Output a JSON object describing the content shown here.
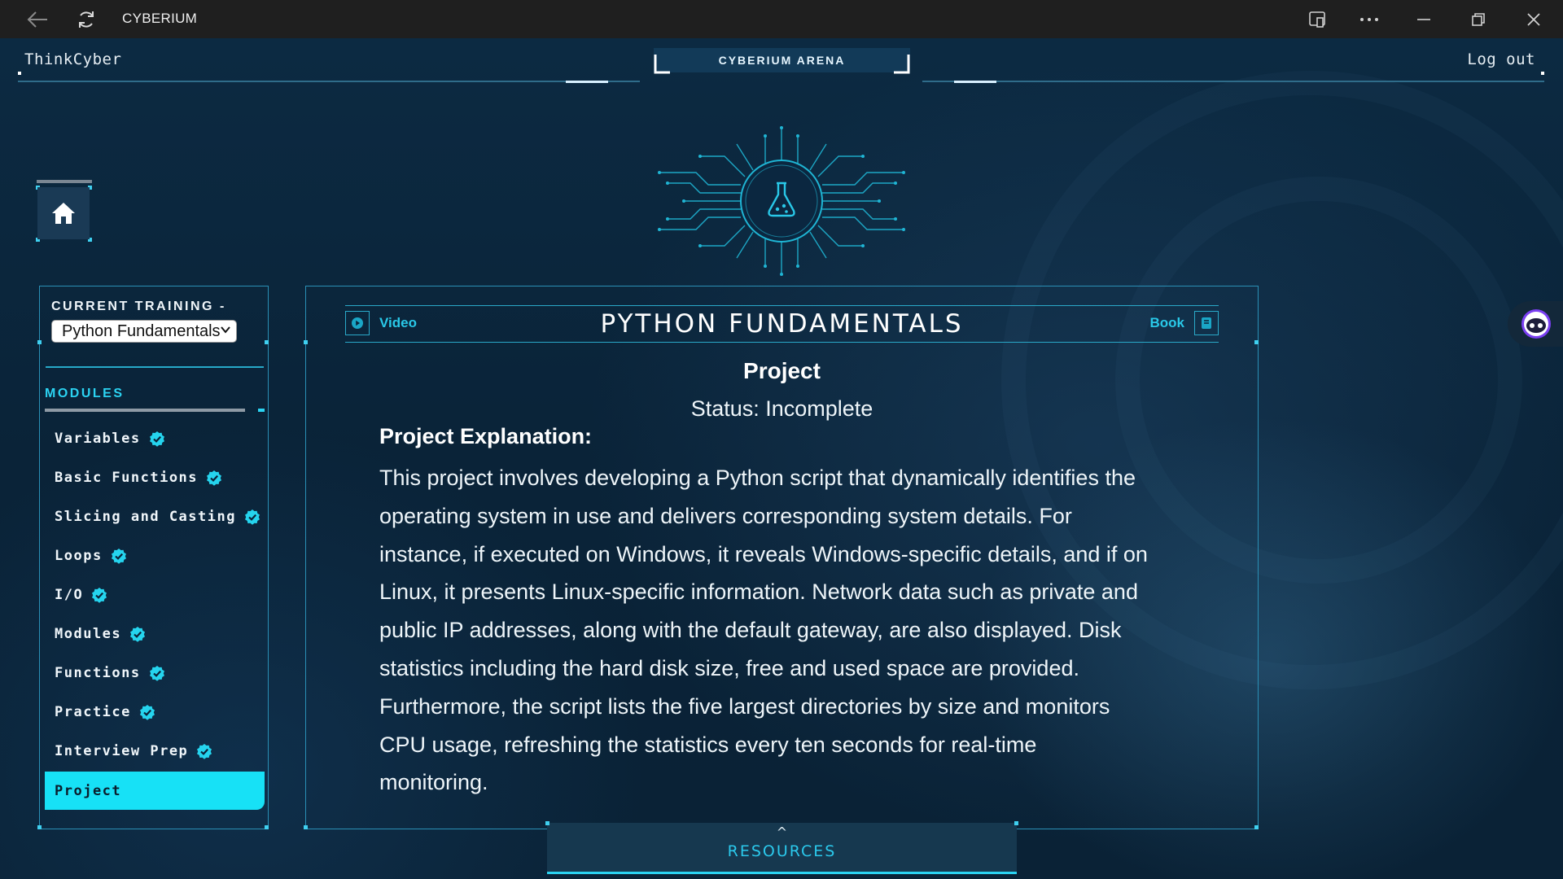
{
  "window": {
    "title": "CYBERIUM"
  },
  "header": {
    "brand": "ThinkCyber",
    "arena_tab": "CYBERIUM ARENA",
    "logout": "Log out"
  },
  "sidebar": {
    "current_training_label": "CURRENT TRAINING -",
    "training_select_value": "Python Fundamentals",
    "modules_label": "MODULES",
    "modules": [
      {
        "label": "Variables",
        "completed": true
      },
      {
        "label": "Basic Functions",
        "completed": true
      },
      {
        "label": "Slicing and Casting",
        "completed": true
      },
      {
        "label": "Loops",
        "completed": true
      },
      {
        "label": "I/O",
        "completed": true
      },
      {
        "label": "Modules",
        "completed": true
      },
      {
        "label": "Functions",
        "completed": true
      },
      {
        "label": "Practice",
        "completed": true
      },
      {
        "label": "Interview Prep",
        "completed": true
      },
      {
        "label": "Project",
        "completed": false,
        "active": true
      }
    ]
  },
  "panel": {
    "video_label": "Video",
    "course_title": "PYTHON FUNDAMENTALS",
    "book_label": "Book",
    "project_title": "Project",
    "status": "Status: Incomplete",
    "explanation_title": "Project Explanation:",
    "explanation_lines": [
      "This project involves developing a Python script that dynamically identifies the",
      "operating system in use and delivers corresponding system details. For",
      "instance, if executed on Windows, it reveals Windows-specific details, and if on",
      "Linux, it presents Linux-specific information. Network data such as private and",
      "public IP addresses, along with the default gateway, are also displayed. Disk",
      "statistics including the hard disk size, free and used space are provided.",
      "Furthermore, the script lists the five largest directories by size and monitors",
      "CPU usage, refreshing the statistics every ten seconds for real-time",
      "monitoring."
    ]
  },
  "resources": {
    "caret": "^",
    "label": "RESOURCES"
  },
  "colors": {
    "accent": "#17e1f6",
    "background": "#0b2238",
    "border": "#2a8fb5"
  },
  "icons": [
    "back-arrow-icon",
    "refresh-icon",
    "cast-icon",
    "more-icon",
    "minimize-icon",
    "maximize-icon",
    "close-icon",
    "home-icon",
    "check-badge-icon",
    "play-icon",
    "book-icon",
    "flask-icon",
    "assistant-icon"
  ]
}
